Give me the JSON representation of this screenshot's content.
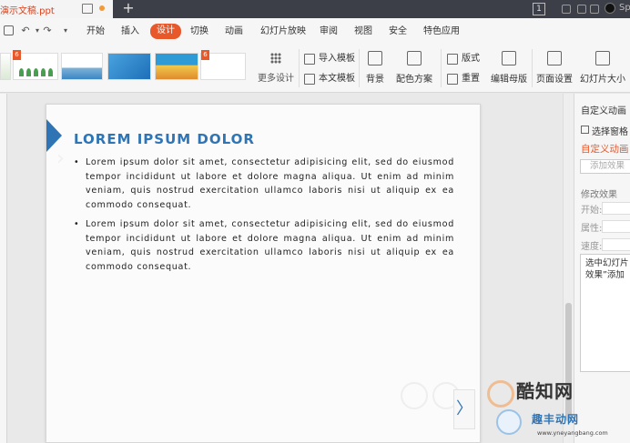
{
  "window": {
    "doc_tab_title": "演示文稿.ppt",
    "new_tab_symbol": "+",
    "page_count_badge": "1",
    "user_text": "Sp"
  },
  "menu": {
    "items": [
      {
        "label": "开始",
        "active": false
      },
      {
        "label": "插入",
        "active": false
      },
      {
        "label": "设计",
        "active": true
      },
      {
        "label": "切换",
        "active": false
      },
      {
        "label": "动画",
        "active": false
      },
      {
        "label": "幻灯片放映",
        "active": false
      },
      {
        "label": "审阅",
        "active": false
      },
      {
        "label": "视图",
        "active": false
      },
      {
        "label": "安全",
        "active": false
      },
      {
        "label": "特色应用",
        "active": false
      }
    ],
    "tools": {
      "undo": "↶",
      "redo": "↷",
      "more": "▾"
    }
  },
  "ribbon": {
    "template_badge": "6",
    "more_design": "更多设计",
    "import_template": "导入模板",
    "text_template": "本文模板",
    "background": "背景",
    "color_scheme": "配色方案",
    "layout": "版式",
    "reset": "重置",
    "edit_master": "编辑母版",
    "page_setup": "页面设置",
    "slide_size": "幻灯片大小"
  },
  "slide": {
    "title": "LOREM IPSUM DOLOR",
    "bullets": [
      "Lorem ipsum dolor sit amet, consectetur adipisicing elit, sed do eiusmod tempor incididunt ut labore et dolore magna aliqua. Ut enim ad minim veniam, quis nostrud exercitation ullamco laboris nisi ut aliquip ex ea commodo consequat.",
      "Lorem ipsum dolor sit amet, consectetur adipisicing elit, sed do eiusmod tempor incididunt ut labore et dolore magna aliqua. Ut enim ad minim veniam, quis nostrud exercitation ullamco laboris nisi ut aliquip ex ea commodo consequat."
    ],
    "accent_color": "#2f74b5"
  },
  "right_pane": {
    "title": "自定义动画",
    "select_pane": "选择窗格",
    "custom_animation": "自定义动画",
    "add_effect": "添加效果",
    "modify_effect": "修改效果",
    "start_label": "开始:",
    "property_label": "属性:",
    "speed_label": "速度:",
    "hint_line1": "选中幻灯片",
    "hint_line2": "效果”添加"
  },
  "watermark": {
    "brand": "酷知网",
    "brand2": "趣丰动网",
    "url": "www.yneyangbang.com"
  },
  "navigation": {
    "next": "〉"
  },
  "colors": {
    "accent": "#e7582b",
    "titlebar": "#3c3f48"
  }
}
